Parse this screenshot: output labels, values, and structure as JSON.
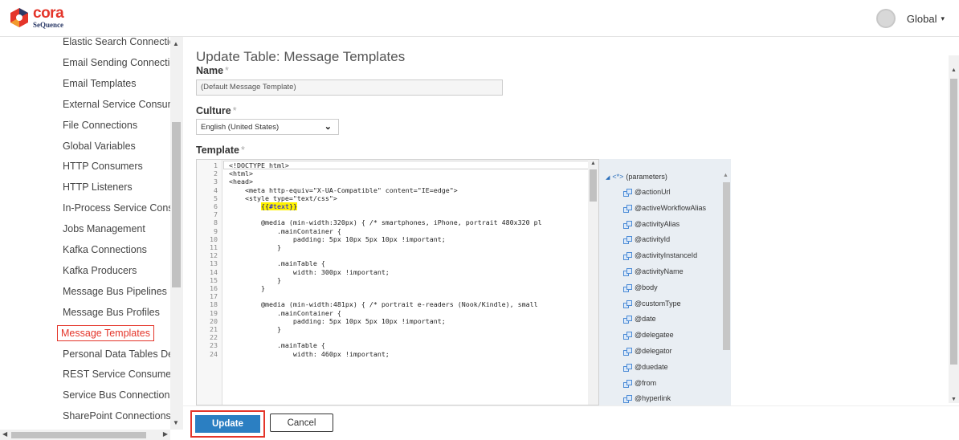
{
  "header": {
    "logo_top": "cora",
    "logo_bottom": "SeQuence",
    "user_label": "Global",
    "user_caret": "▾"
  },
  "sidebar": {
    "items": [
      {
        "label": "Elastic Search Connections"
      },
      {
        "label": "Email Sending Connections"
      },
      {
        "label": "Email Templates"
      },
      {
        "label": "External Service Consumers"
      },
      {
        "label": "File Connections"
      },
      {
        "label": "Global Variables"
      },
      {
        "label": "HTTP Consumers"
      },
      {
        "label": "HTTP Listeners"
      },
      {
        "label": "In-Process Service Consume"
      },
      {
        "label": "Jobs Management"
      },
      {
        "label": "Kafka Connections"
      },
      {
        "label": "Kafka Producers"
      },
      {
        "label": "Message Bus Pipelines"
      },
      {
        "label": "Message Bus Profiles"
      },
      {
        "label": "Message Templates",
        "active": true
      },
      {
        "label": "Personal Data Tables Definit"
      },
      {
        "label": "REST Service Consumers"
      },
      {
        "label": "Service Bus Connections"
      },
      {
        "label": "SharePoint Connections"
      }
    ]
  },
  "main": {
    "title": "Update Table: Message Templates",
    "name_label": "Name",
    "name_value": "(Default Message Template)",
    "culture_label": "Culture",
    "culture_value": "English (United States)",
    "template_label": "Template",
    "required_mark": "*"
  },
  "editor": {
    "lines": [
      {
        "n": "1",
        "code": "<!DOCTYPE html>"
      },
      {
        "n": "2",
        "code": "<html>"
      },
      {
        "n": "3",
        "code": "<head>"
      },
      {
        "n": "4",
        "code": "    <meta http-equiv=\"X-UA-Compatible\" content=\"IE=edge\">"
      },
      {
        "n": "5",
        "code": "    <style type=\"text/css\">"
      },
      {
        "n": "6",
        "code": "        ",
        "hl_open": "{{",
        "hl_text": "#text",
        "hl_close": "}}"
      },
      {
        "n": "7",
        "code": ""
      },
      {
        "n": "8",
        "code": "        @media (min-width:320px) { /* smartphones, iPhone, portrait 480x320 pl"
      },
      {
        "n": "9",
        "code": "            .mainContainer {"
      },
      {
        "n": "10",
        "code": "                padding: 5px 10px 5px 10px !important;"
      },
      {
        "n": "11",
        "code": "            }"
      },
      {
        "n": "12",
        "code": ""
      },
      {
        "n": "13",
        "code": "            .mainTable {"
      },
      {
        "n": "14",
        "code": "                width: 300px !important;"
      },
      {
        "n": "15",
        "code": "            }"
      },
      {
        "n": "16",
        "code": "        }"
      },
      {
        "n": "17",
        "code": ""
      },
      {
        "n": "18",
        "code": "        @media (min-width:481px) { /* portrait e-readers (Nook/Kindle), small"
      },
      {
        "n": "19",
        "code": "            .mainContainer {"
      },
      {
        "n": "20",
        "code": "                padding: 5px 10px 5px 10px !important;"
      },
      {
        "n": "21",
        "code": "            }"
      },
      {
        "n": "22",
        "code": ""
      },
      {
        "n": "23",
        "code": "            .mainTable {"
      },
      {
        "n": "24",
        "code": "                width: 460px !important;"
      }
    ]
  },
  "tree": {
    "root_label": "(parameters)",
    "root_icon": "<*>",
    "items": [
      "@actionUrl",
      "@activeWorkflowAlias",
      "@activityAlias",
      "@activityId",
      "@activityInstanceId",
      "@activityName",
      "@body",
      "@customType",
      "@date",
      "@delegatee",
      "@delegator",
      "@duedate",
      "@from",
      "@hyperlink"
    ]
  },
  "footer": {
    "update_label": "Update",
    "cancel_label": "Cancel"
  },
  "colors": {
    "accent": "#e4352a",
    "primary_button": "#2b7fc2",
    "tree_bg": "#e9eef3"
  }
}
